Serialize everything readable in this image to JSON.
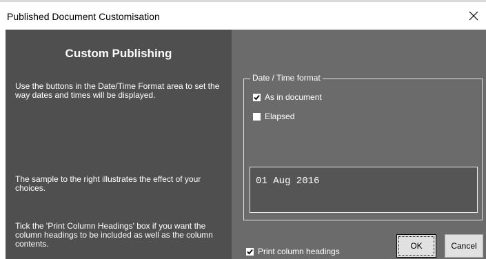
{
  "window": {
    "title": "Published Document Customisation"
  },
  "left_panel": {
    "heading": "Custom Publishing",
    "paragraph1": "Use the buttons in the Date/Time Format area to set the way dates and times will be displayed.",
    "paragraph2": "The sample to the right illustrates the effect of your choices.",
    "paragraph3": "Tick the 'Print Column Headings' box if you want the column headings to be included as well as the column contents."
  },
  "date_time_format": {
    "group_title": "Date / Time format",
    "options": [
      {
        "label": "As in document",
        "checked": true
      },
      {
        "label": "Elapsed",
        "checked": false
      }
    ]
  },
  "sample": {
    "value": "01 Aug 2016"
  },
  "print_column_headings": {
    "label": "Print column headings",
    "checked": true
  },
  "buttons": {
    "ok": "OK",
    "cancel": "Cancel"
  },
  "icons": {
    "close": "close-icon",
    "check": "checkmark-icon"
  },
  "colors": {
    "left_panel": "#4f4f4f",
    "right_panel": "#6b6b6b",
    "sample_box": "#555555",
    "text": "#ffffff"
  }
}
